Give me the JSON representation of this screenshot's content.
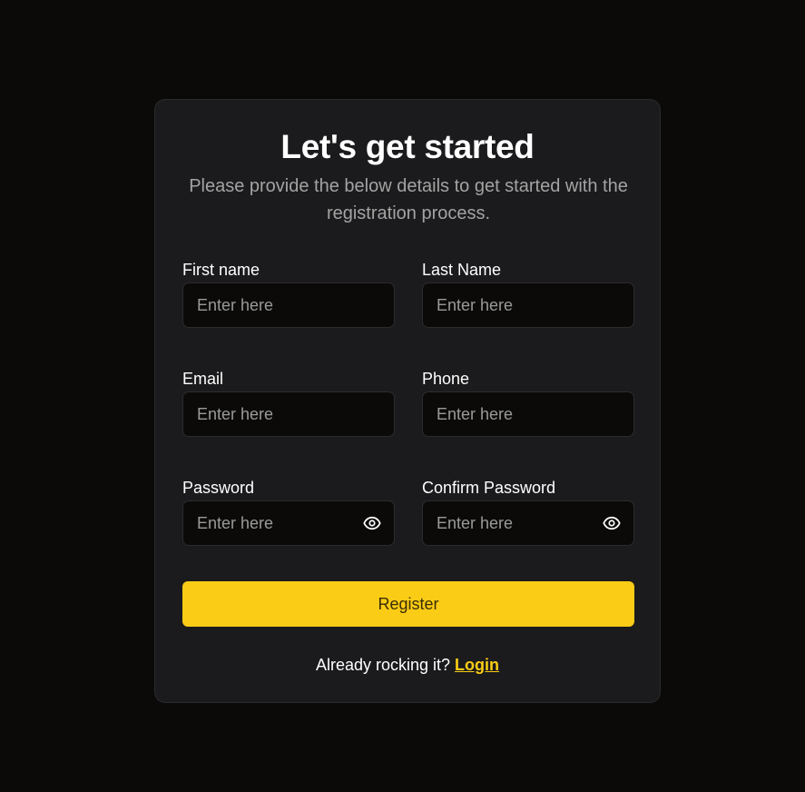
{
  "form": {
    "title": "Let's get started",
    "subtitle": "Please provide the below details to get started with the registration process.",
    "fields": {
      "first_name": {
        "label": "First name",
        "placeholder": "Enter here",
        "value": ""
      },
      "last_name": {
        "label": "Last Name",
        "placeholder": "Enter here",
        "value": ""
      },
      "email": {
        "label": "Email",
        "placeholder": "Enter here",
        "value": ""
      },
      "phone": {
        "label": "Phone",
        "placeholder": "Enter here",
        "value": ""
      },
      "password": {
        "label": "Password",
        "placeholder": "Enter here",
        "value": "",
        "icon": "eye-icon"
      },
      "confirm_password": {
        "label": "Confirm Password",
        "placeholder": "Enter here",
        "value": "",
        "icon": "eye-icon"
      }
    },
    "register_label": "Register",
    "footer_text": "Already rocking it?",
    "login_label": "Login"
  },
  "colors": {
    "background": "#0b0a09",
    "card": "#1b1b1d",
    "accent": "#facc15",
    "muted_text": "#a3a3a3"
  }
}
